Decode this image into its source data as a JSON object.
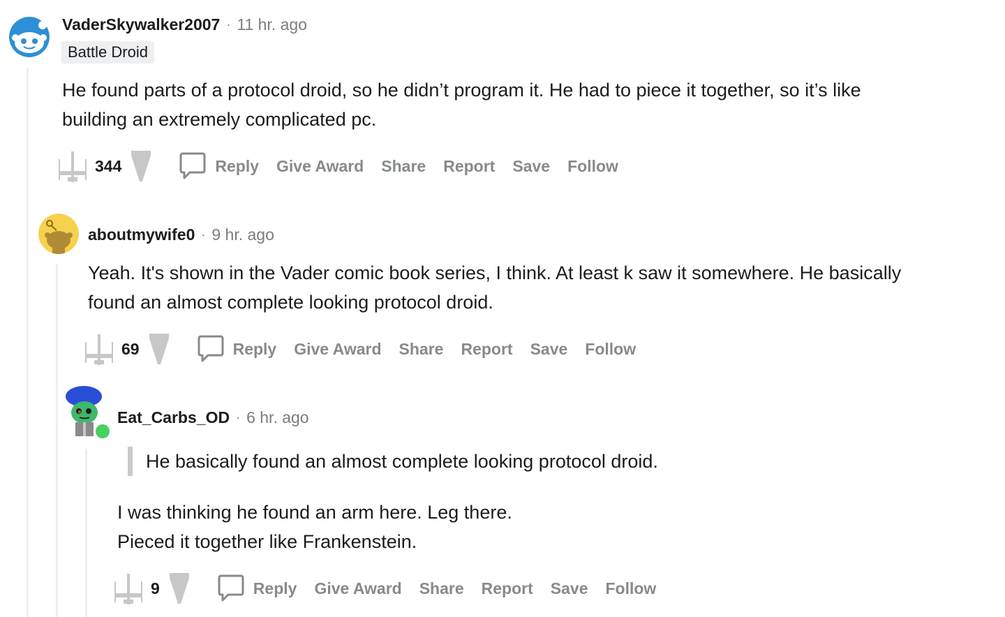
{
  "comments": [
    {
      "username": "VaderSkywalker2007",
      "time": "11 hr. ago",
      "flair": "Battle Droid",
      "body": [
        "He found parts of a protocol droid, so he didn’t program it. He had to piece it together, so it’s like",
        "building an extremely complicated pc."
      ],
      "score": "344",
      "avatar_color": "#2d8fd5"
    },
    {
      "username": "aboutmywife0",
      "time": "9 hr. ago",
      "body": [
        "Yeah. It's shown in the Vader comic book series, I think. At least k saw it somewhere. He basically",
        "found an almost complete looking protocol droid."
      ],
      "score": "69",
      "avatar_color": "#f5d14d"
    },
    {
      "username": "Eat_Carbs_OD",
      "time": "6 hr. ago",
      "quote": "He basically found an almost complete looking protocol droid.",
      "body": [
        "I was thinking he found an arm here. Leg there.",
        "Pieced it together like Frankenstein."
      ],
      "score": "9",
      "online_color": "#46d160"
    }
  ],
  "actions": {
    "reply": "Reply",
    "give_award": "Give Award",
    "share": "Share",
    "report": "Report",
    "save": "Save",
    "follow": "Follow"
  },
  "icons": {
    "upvote": "xwing-upvote-icon",
    "downvote": "stardestroyer-downvote-icon",
    "reply": "speech-bubble-icon"
  },
  "colors": {
    "text": "#1c1c1c",
    "muted": "#878a8c",
    "thread_line": "#edeff1",
    "flair_bg": "#edeff1"
  }
}
